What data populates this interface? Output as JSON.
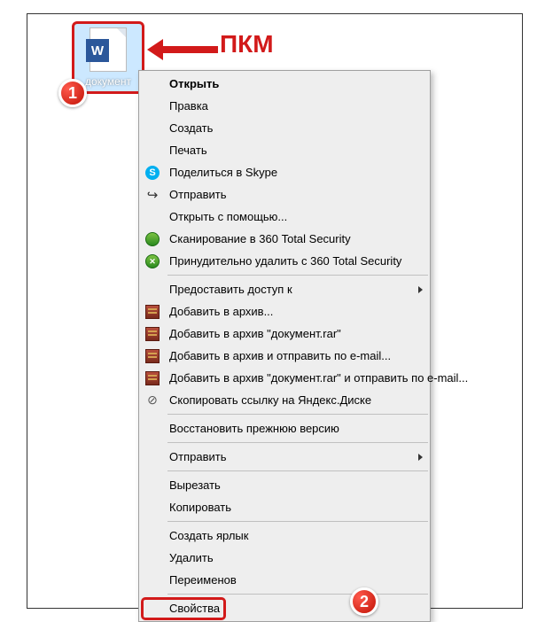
{
  "annotations": {
    "pkm_label": "ПКМ",
    "step1": "1",
    "step2": "2"
  },
  "file": {
    "name": "документ",
    "app_letter": "W"
  },
  "menu": {
    "open": "Открыть",
    "edit": "Правка",
    "create": "Создать",
    "print": "Печать",
    "share_skype": "Поделиться в Skype",
    "send_1": "Отправить",
    "open_with": "Открыть с помощью...",
    "scan_360": "Сканирование в 360 Total Security",
    "force_delete_360": "Принудительно удалить с  360 Total Security",
    "grant_access": "Предоставить доступ к",
    "rar_add": "Добавить в архив...",
    "rar_add_named": "Добавить в архив \"документ.rar\"",
    "rar_add_email": "Добавить в архив и отправить по e-mail...",
    "rar_add_named_email": "Добавить в архив \"документ.rar\" и отправить по e-mail...",
    "yadisk_copy": "Скопировать ссылку на Яндекс.Диске",
    "restore_prev": "Восстановить прежнюю версию",
    "send_2": "Отправить",
    "cut": "Вырезать",
    "copy": "Копировать",
    "create_shortcut": "Создать ярлык",
    "delete": "Удалить",
    "rename": "Переименов",
    "properties": "Свойства"
  }
}
